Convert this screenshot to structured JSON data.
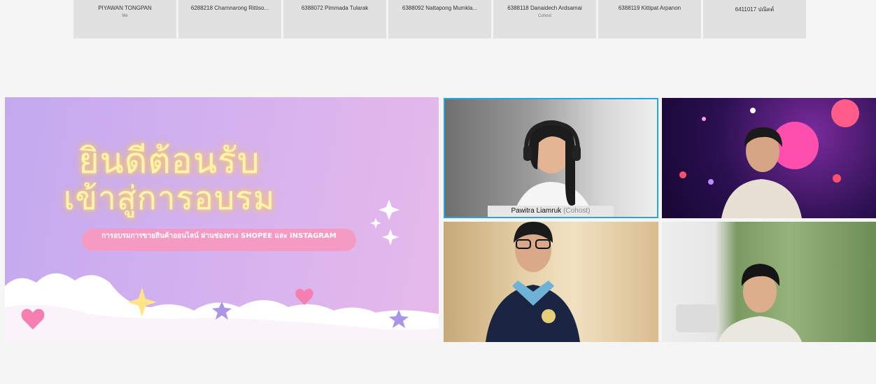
{
  "participants": [
    {
      "name": "PIYAWAN TONGPAN",
      "role": "Me"
    },
    {
      "name": "6288218 Charnnarong Rittiso...",
      "role": ""
    },
    {
      "name": "6388072 Pimmada Tularak",
      "role": ""
    },
    {
      "name": "6388092 Nattapong Mumkla...",
      "role": ""
    },
    {
      "name": "6388118 Danaidech Ardsamai",
      "role": "Cohost"
    },
    {
      "name": "6388119 Kittipat Arpanon",
      "role": ""
    },
    {
      "name": "6411017 ปณิตต์",
      "role": ""
    }
  ],
  "shared_screen": {
    "line1": "ยินดีต้อนรับ",
    "line2": "เข้าสู่การอบรม",
    "subtitle": "การอบรมการขายสินค้าออนไลน์ ผ่านช่องทาง SHOPEE และ INSTAGRAM",
    "accent_colors": {
      "pill": "#f59ac3",
      "title_glow": "#ffd76b",
      "background": "#d3b1ef"
    }
  },
  "videos": {
    "active_speaker": {
      "name": "Pawitra Liamruk",
      "role": "(Cohost)"
    },
    "active_border_color": "#2aa6d6"
  }
}
